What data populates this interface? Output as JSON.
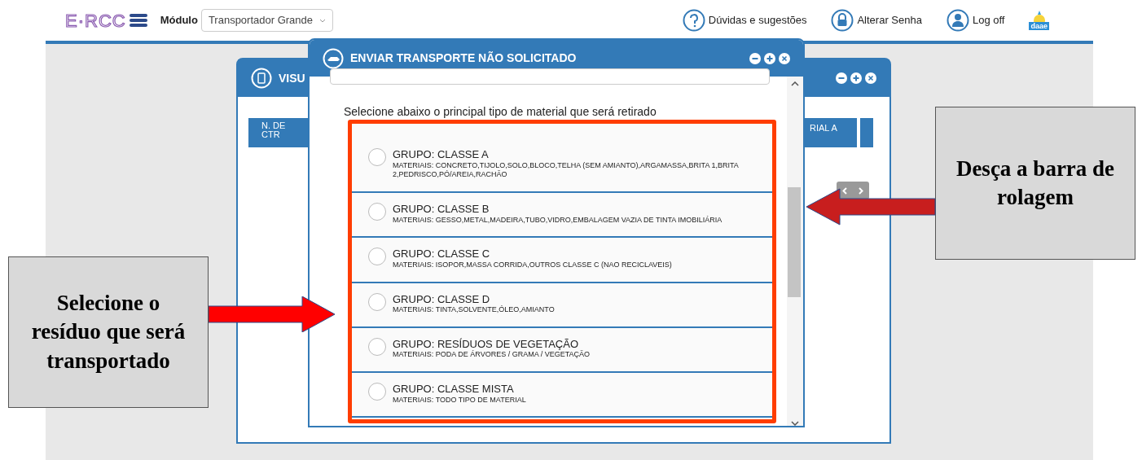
{
  "header": {
    "logo_text": "E·RCC",
    "module_label": "Módulo",
    "module_select": {
      "value": "Transportador Grande"
    },
    "links": [
      {
        "kind": "help",
        "label": "Dúvidas e sugestões"
      },
      {
        "kind": "lock",
        "label": "Alterar Senha"
      },
      {
        "kind": "user",
        "label": "Log off"
      }
    ],
    "brand_logo_text": "daae"
  },
  "background_window": {
    "title": "VISU",
    "columns": [
      "N. DE CTR",
      "RIAL A"
    ]
  },
  "modal": {
    "title": "ENVIAR TRANSPORTE NÃO SOLICITADO",
    "instruction": "Selecione abaixo o principal tipo de material que será retirado",
    "options": [
      {
        "group": "GRUPO: CLASSE A",
        "materials": "MATERIAIS:  CONCRETO,TIJOLO,SOLO,BLOCO,TELHA (SEM AMIANTO),ARGAMASSA,BRITA 1,BRITA 2,PEDRISCO,PÓ/AREIA,RACHÃO",
        "selected": false
      },
      {
        "group": "GRUPO: CLASSE B",
        "materials": "MATERIAIS:  GESSO,METAL,MADEIRA,TUBO,VIDRO,EMBALAGEM VAZIA DE TINTA IMOBILIÁRIA",
        "selected": false
      },
      {
        "group": "GRUPO: CLASSE C",
        "materials": "MATERIAIS:  ISOPOR,MASSA CORRIDA,OUTROS CLASSE C (NAO RECICLAVEIS)",
        "selected": false
      },
      {
        "group": "GRUPO: CLASSE D",
        "materials": "MATERIAIS:  TINTA,SOLVENTE,ÓLEO,AMIANTO",
        "selected": false
      },
      {
        "group": "GRUPO: RESÍDUOS DE VEGETAÇÃO",
        "materials": "MATERIAIS:  PODA DE ÁRVORES / GRAMA / VEGETAÇÃO",
        "selected": false
      },
      {
        "group": "GRUPO: CLASSE MISTA",
        "materials": "MATERIAIS:  TODO TIPO DE MATERIAL",
        "selected": false
      }
    ]
  },
  "annotations": [
    {
      "kind": "left",
      "text": "Selecione o resíduo que será transportado"
    },
    {
      "kind": "right",
      "text": "Desça a barra de rolagem"
    }
  ]
}
